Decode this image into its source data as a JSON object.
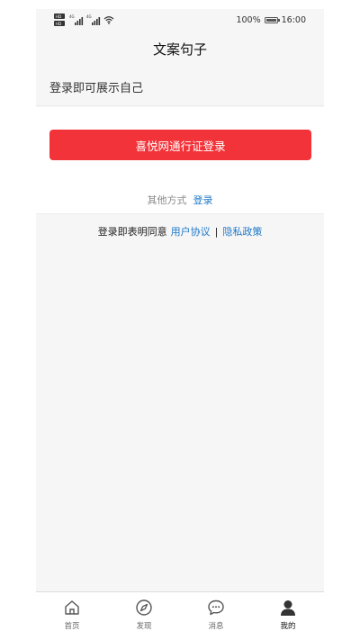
{
  "status_bar": {
    "hd_top": "HD",
    "hd_bottom": "HD",
    "net1": "4G",
    "net2": "4G",
    "battery_percent": "100%",
    "battery_level": 1.0,
    "time": "16:00"
  },
  "header": {
    "title": "文案句子"
  },
  "main": {
    "prompt": "登录即可展示自己",
    "primary_login_label": "喜悦网通行证登录",
    "other_methods_label": "其他方式",
    "other_login_link": "登录",
    "agreement_prefix": "登录即表明同意",
    "user_agreement": "用户协议",
    "separator": "|",
    "privacy_policy": "隐私政策"
  },
  "tab_bar": {
    "items": [
      {
        "label": "首页",
        "icon": "home-icon",
        "active": false
      },
      {
        "label": "发现",
        "icon": "compass-icon",
        "active": false
      },
      {
        "label": "消息",
        "icon": "chat-bubble-icon",
        "active": false
      },
      {
        "label": "我的",
        "icon": "person-icon",
        "active": true
      }
    ]
  },
  "colors": {
    "primary_button": "#f23339",
    "link": "#1e78c8",
    "page_background": "#f6f6f6"
  }
}
